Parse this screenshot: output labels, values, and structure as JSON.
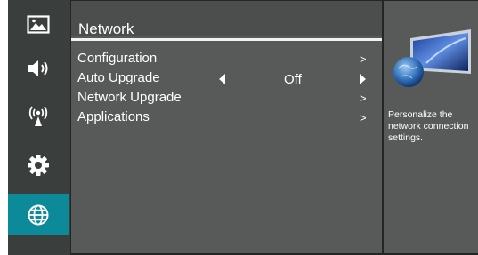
{
  "sidebar": {
    "items": [
      {
        "icon": "picture-icon",
        "active": false
      },
      {
        "icon": "speaker-icon",
        "active": false
      },
      {
        "icon": "broadcast-icon",
        "active": false
      },
      {
        "icon": "gear-icon",
        "active": false
      },
      {
        "icon": "globe-icon",
        "active": true
      }
    ],
    "active_color": "#0d8a99"
  },
  "main": {
    "title": "Network",
    "menu": [
      {
        "label": "Configuration",
        "arrow": ">"
      },
      {
        "label": "Auto Upgrade",
        "value": "Off"
      },
      {
        "label": "Network Upgrade",
        "arrow": ">"
      },
      {
        "label": "Applications",
        "arrow": ">"
      }
    ]
  },
  "info": {
    "description": "Personalize the network connection settings."
  }
}
